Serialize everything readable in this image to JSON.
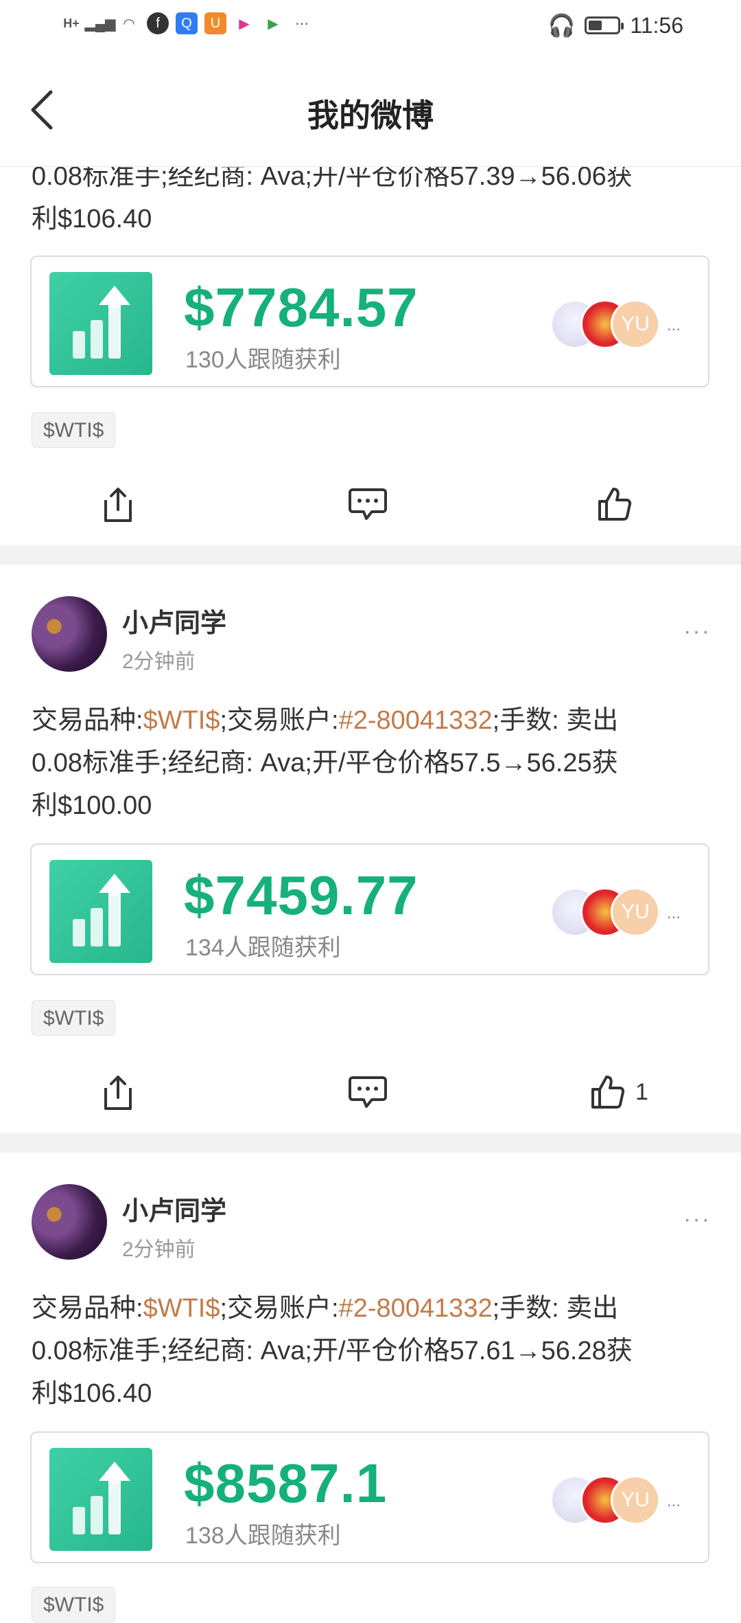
{
  "status_bar": {
    "time": "11:56",
    "network": "H+"
  },
  "nav": {
    "title": "我的微博"
  },
  "posts": [
    {
      "text_tail_line1": "0.08标准手;经纪商: Ava;开/平仓价格57.39→56.06获",
      "text_tail_line2": "利$106.40",
      "amount": "$7784.57",
      "followers": "130人跟随获利",
      "avatar3_text": "YU",
      "tag": "$WTI$",
      "like_count": ""
    },
    {
      "user": "小卢同学",
      "time": "2分钟前",
      "prefix1": "交易品种:",
      "symbol": "$WTI$",
      "prefix2": ";交易账户:",
      "account": "#2-80041332",
      "suffix1": ";手数: 卖出",
      "line2": "0.08标准手;经纪商: Ava;开/平仓价格57.5→56.25获",
      "line3": "利$100.00",
      "amount": "$7459.77",
      "followers": "134人跟随获利",
      "avatar3_text": "YU",
      "tag": "$WTI$",
      "like_count": "1"
    },
    {
      "user": "小卢同学",
      "time": "2分钟前",
      "prefix1": "交易品种:",
      "symbol": "$WTI$",
      "prefix2": ";交易账户:",
      "account": "#2-80041332",
      "suffix1": ";手数: 卖出",
      "line2": "0.08标准手;经纪商: Ava;开/平仓价格57.61→56.28获",
      "line3": "利$106.40",
      "amount": "$8587.1",
      "followers": "138人跟随获利",
      "avatar3_text": "YU",
      "tag": "$WTI$"
    }
  ],
  "card_more": "...",
  "post_more": "···",
  "colors": {
    "accent_green": "#16b07b",
    "link_orange": "#c27b48"
  },
  "icons": [
    "back-icon",
    "share-icon",
    "comment-icon",
    "like-icon",
    "chart-up-icon"
  ]
}
